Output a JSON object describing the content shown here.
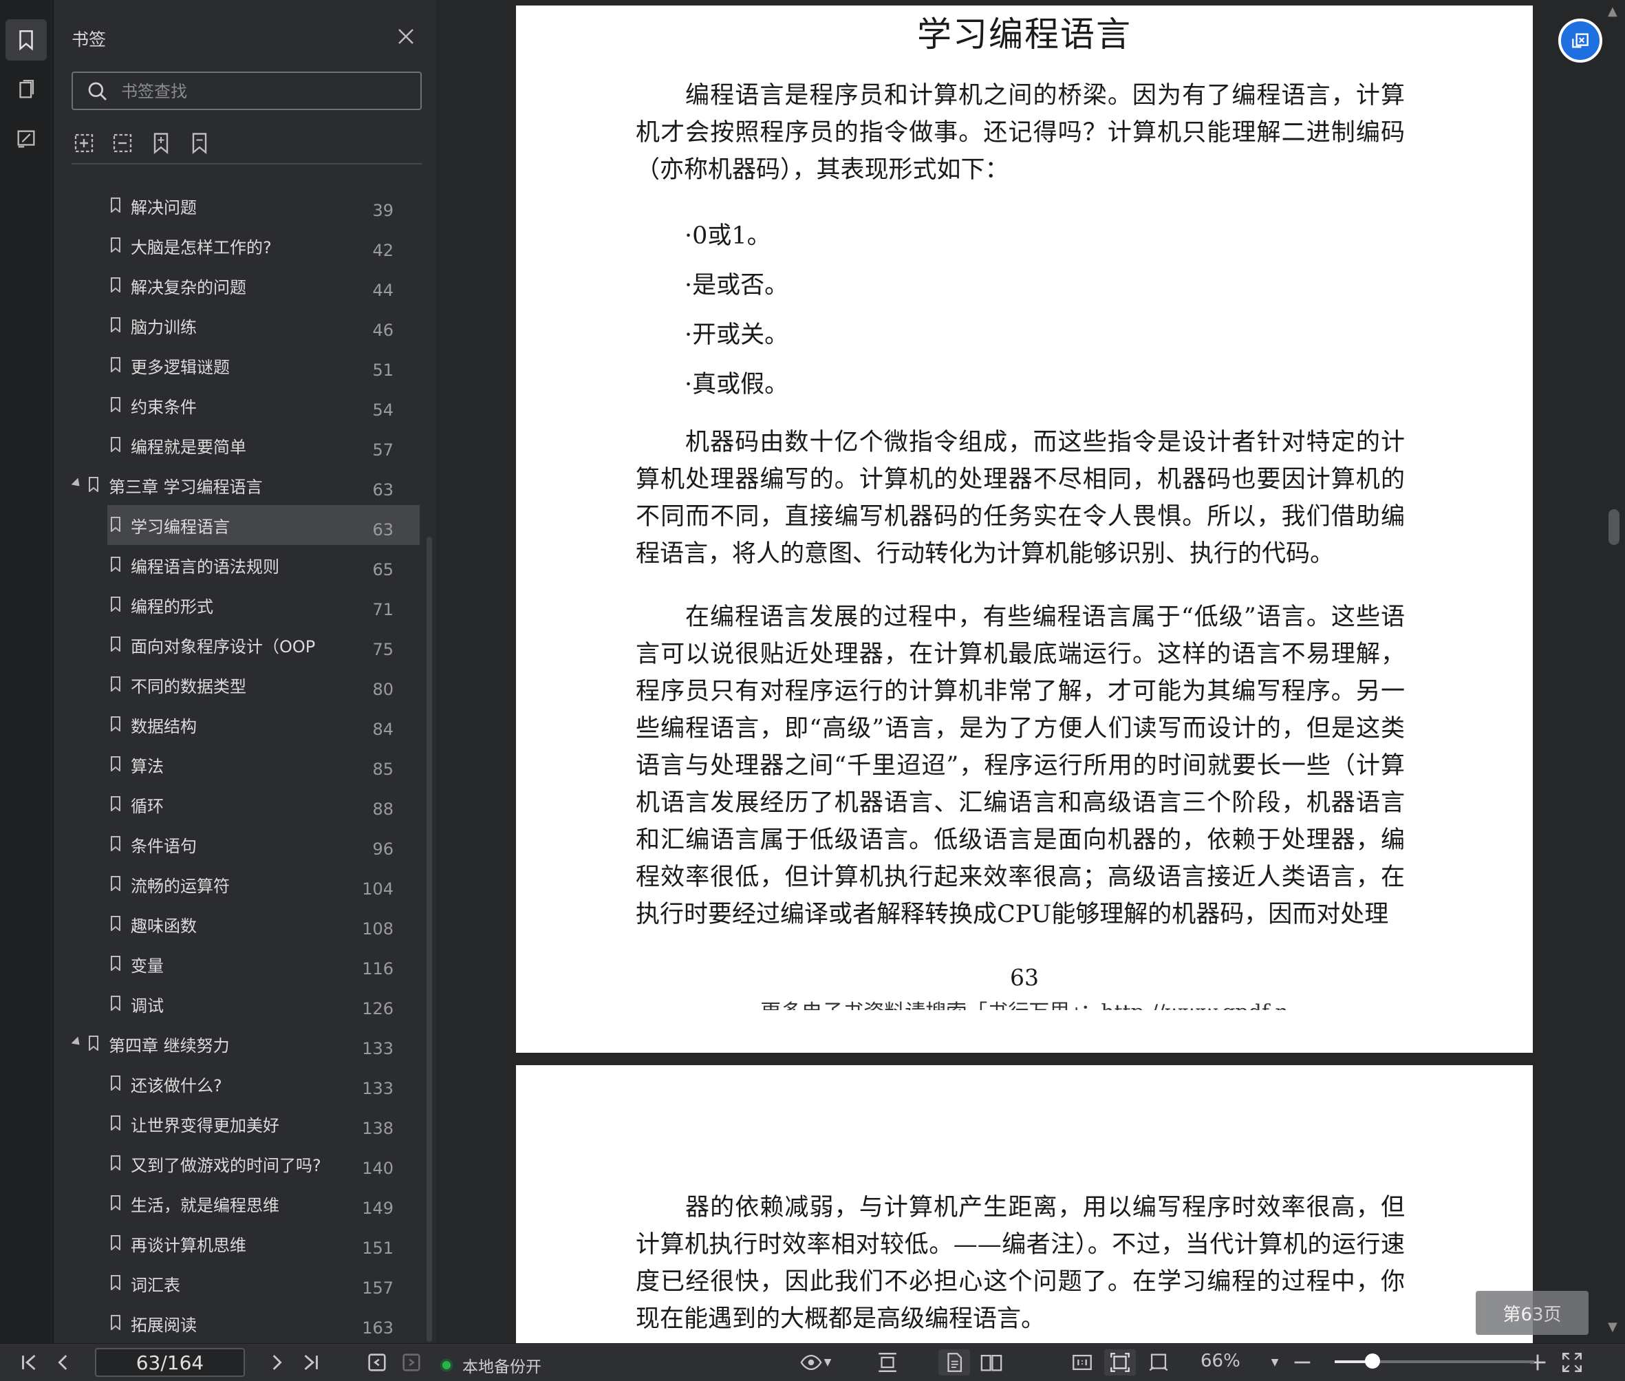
{
  "sidebar": {
    "title": "书签",
    "search_placeholder": "书签查找",
    "bookmarks": [
      {
        "label": "解决问题",
        "page": "39",
        "level": 2
      },
      {
        "label": "大脑是怎样工作的?",
        "page": "42",
        "level": 2
      },
      {
        "label": "解决复杂的问题",
        "page": "44",
        "level": 2
      },
      {
        "label": "脑力训练",
        "page": "46",
        "level": 2
      },
      {
        "label": "更多逻辑谜题",
        "page": "51",
        "level": 2
      },
      {
        "label": "约束条件",
        "page": "54",
        "level": 2
      },
      {
        "label": "编程就是要简单",
        "page": "57",
        "level": 2
      },
      {
        "label": "第三章 学习编程语言",
        "page": "63",
        "level": 1
      },
      {
        "label": "学习编程语言",
        "page": "63",
        "level": 2,
        "selected": true
      },
      {
        "label": "编程语言的语法规则",
        "page": "65",
        "level": 2
      },
      {
        "label": "编程的形式",
        "page": "71",
        "level": 2
      },
      {
        "label": "面向对象程序设计（OOP",
        "page": "75",
        "level": 2
      },
      {
        "label": "不同的数据类型",
        "page": "80",
        "level": 2
      },
      {
        "label": "数据结构",
        "page": "84",
        "level": 2
      },
      {
        "label": "算法",
        "page": "85",
        "level": 2
      },
      {
        "label": "循环",
        "page": "88",
        "level": 2
      },
      {
        "label": "条件语句",
        "page": "96",
        "level": 2
      },
      {
        "label": "流畅的运算符",
        "page": "104",
        "level": 2
      },
      {
        "label": "趣味函数",
        "page": "108",
        "level": 2
      },
      {
        "label": "变量",
        "page": "116",
        "level": 2
      },
      {
        "label": "调试",
        "page": "126",
        "level": 2
      },
      {
        "label": "第四章 继续努力",
        "page": "133",
        "level": 1
      },
      {
        "label": "还该做什么?",
        "page": "133",
        "level": 2
      },
      {
        "label": "让世界变得更加美好",
        "page": "138",
        "level": 2
      },
      {
        "label": "又到了做游戏的时间了吗?",
        "page": "140",
        "level": 2
      },
      {
        "label": "生活，就是编程思维",
        "page": "149",
        "level": 2
      },
      {
        "label": "再谈计算机思维",
        "page": "151",
        "level": 2
      },
      {
        "label": "词汇表",
        "page": "157",
        "level": 2
      },
      {
        "label": "拓展阅读",
        "page": "163",
        "level": 2
      }
    ]
  },
  "document": {
    "page1": {
      "title": "学习编程语言",
      "para1": "编程语言是程序员和计算机之间的桥梁。因为有了编程语言，计算机才会按照程序员的指令做事。还记得吗？计算机只能理解二进制编码（亦称机器码），其表现形式如下：",
      "bullets": [
        "·0或1。",
        "·是或否。",
        "·开或关。",
        "·真或假。"
      ],
      "para2": "机器码由数十亿个微指令组成，而这些指令是设计者针对特定的计算机处理器编写的。计算机的处理器不尽相同，机器码也要因计算机的不同而不同，直接编写机器码的任务实在令人畏惧。所以，我们借助编程语言，将人的意图、行动转化为计算机能够识别、执行的代码。",
      "para3": "在编程语言发展的过程中，有些编程语言属于“低级”语言。这些语言可以说很贴近处理器，在计算机最底端运行。这样的语言不易理解，程序员只有对程序运行的计算机非常了解，才可能为其编写程序。另一些编程语言，即“高级”语言，是为了方便人们读写而设计的，但是这类语言与处理器之间“千里迢迢”，程序运行所用的时间就要长一些（计算机语言发展经历了机器语言、汇编语言和高级语言三个阶段，机器语言和汇编语言属于低级语言。低级语言是面向机器的，依赖于处理器，编程效率很低，但计算机执行起来效率很高；高级语言接近人类语言，在执行时要经过编译或者解释转换成CPU能够理解的机器码，因而对处理",
      "page_number": "63",
      "footer": "更多电子书资料请搜索「书行万里」：http://www.gpdf.n"
    },
    "page2": {
      "para1": "器的依赖减弱，与计算机产生距离，用以编写程序时效率很高，但计算机执行时效率相对较低。——编者注）。不过，当代计算机的运行速度已经很快，因此我们不必担心这个问题了。在学习编程的过程中，你现在能遇到的大概都是高级编程语言。"
    },
    "page_badge": "第63页"
  },
  "toolbar": {
    "page_indicator": "63/164",
    "backup_status": "本地备份开",
    "zoom": "66%",
    "zoom_level": 0.19
  },
  "colors": {
    "accent": "#1e6fe0",
    "status_green": "#2bb24c",
    "selected_row": "#45464a"
  }
}
